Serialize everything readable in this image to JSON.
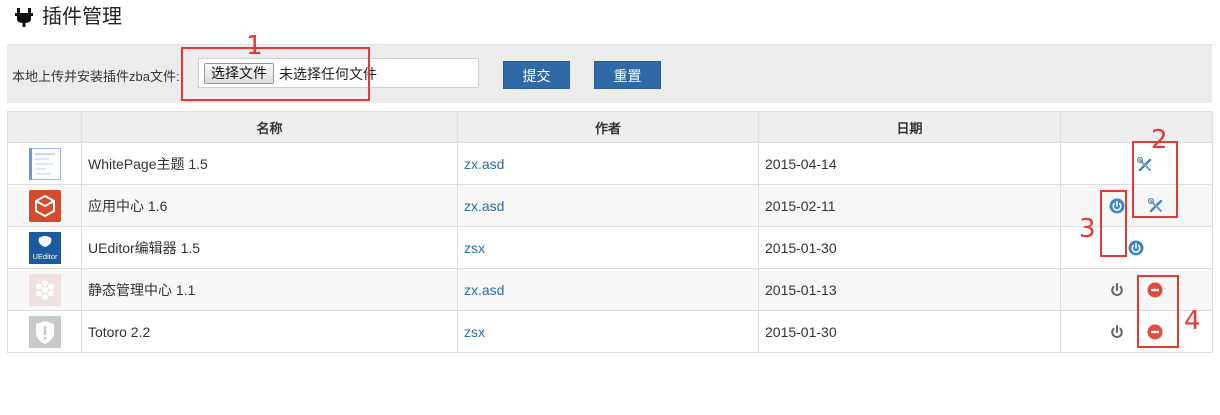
{
  "header": {
    "title": "插件管理"
  },
  "upload": {
    "label": "本地上传并安装插件zba文件:",
    "choose_label": "选择文件",
    "file_status": "未选择任何文件",
    "submit_label": "提交",
    "reset_label": "重置"
  },
  "table": {
    "columns": [
      "",
      "名称",
      "作者",
      "日期",
      ""
    ],
    "rows": [
      {
        "name": "WhitePage主题 1.5",
        "author": "zx.asd",
        "date": "2015-04-14"
      },
      {
        "name": "应用中心 1.6",
        "author": "zx.asd",
        "date": "2015-02-11"
      },
      {
        "name": "UEditor编辑器 1.5",
        "author": "zsx",
        "date": "2015-01-30",
        "thumb_text": "UEditor"
      },
      {
        "name": "静态管理中心 1.1",
        "author": "zx.asd",
        "date": "2015-01-13"
      },
      {
        "name": "Totoro 2.2",
        "author": "zsx",
        "date": "2015-01-30"
      }
    ]
  },
  "annotations": [
    "1",
    "2",
    "3",
    "4"
  ],
  "colors": {
    "accent_blue": "#2f6aa6",
    "link_blue": "#2e6da4",
    "annotation_red": "#e53935"
  },
  "icons": {
    "title": "plug-icon",
    "configure": "wrench-screwdriver-icon",
    "enable": "power-blue-icon",
    "disable": "power-gray-icon",
    "uninstall": "minus-circle-red-icon"
  }
}
